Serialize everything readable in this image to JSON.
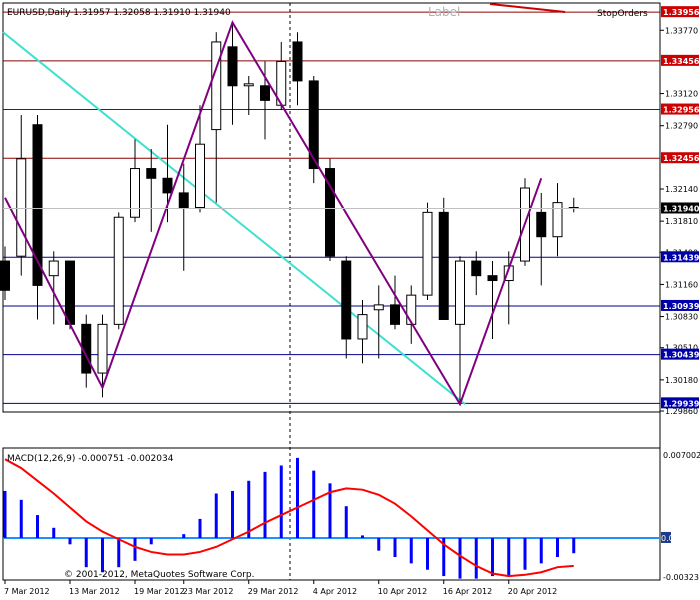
{
  "header": {
    "symbol_line": "EURUSD,Daily  1.31957 1.32058 1.31910 1.31940",
    "label_text": "Label",
    "stop_orders": "StopOrders"
  },
  "indicator": {
    "title": "MACD(12,26,9) -0.000751 -0.002034"
  },
  "copyright": "© 2001-2012, MetaQuotes Software Corp.",
  "colors": {
    "up_candle": "#ffffff",
    "down_candle": "#000000",
    "resistance_line": "#8b0000",
    "support_line": "#00008b",
    "zigzag": "#800080",
    "trendline": "#40e0d0",
    "macd_histogram": "#0000ff",
    "macd_signal": "#ff0000",
    "zero_line": "#1e90ff",
    "price_tag_red": "#cc0000",
    "price_tag_blue": "#0000aa",
    "current_price_tag": "#000000"
  },
  "price_axis": {
    "labels": [
      "1.33770",
      "1.33120",
      "1.32790",
      "1.32140",
      "1.31810",
      "1.31490",
      "1.31160",
      "1.30830",
      "1.30510",
      "1.30180",
      "1.29860"
    ],
    "tags": [
      {
        "text": "1.33956",
        "kind": "resistance"
      },
      {
        "text": "1.33456",
        "kind": "resistance"
      },
      {
        "text": "1.32956",
        "kind": "resistance"
      },
      {
        "text": "1.32456",
        "kind": "resistance"
      },
      {
        "text": "1.31940",
        "kind": "current"
      },
      {
        "text": "1.31439",
        "kind": "support"
      },
      {
        "text": "1.30939",
        "kind": "support"
      },
      {
        "text": "1.30439",
        "kind": "support"
      },
      {
        "text": "1.29939",
        "kind": "support"
      }
    ]
  },
  "macd_axis": {
    "labels": [
      "0.007002",
      "0.00",
      "-0.00323"
    ]
  },
  "time_axis": {
    "labels": [
      "7 Mar 2012",
      "13 Mar 2012",
      "19 Mar 2012",
      "23 Mar 2012",
      "29 Mar 2012",
      "4 Apr 2012",
      "10 Apr 2012",
      "16 Apr 2012",
      "20 Apr 2012"
    ]
  },
  "chart_data": {
    "type": "candlestick",
    "symbol": "EURUSD",
    "timeframe": "Daily",
    "ylim": [
      1.2985,
      1.3405
    ],
    "candles": [
      {
        "o": 1.314,
        "h": 1.3155,
        "l": 1.31,
        "c": 1.311
      },
      {
        "o": 1.3145,
        "h": 1.329,
        "l": 1.3125,
        "c": 1.3245
      },
      {
        "o": 1.328,
        "h": 1.329,
        "l": 1.308,
        "c": 1.3115
      },
      {
        "o": 1.3125,
        "h": 1.315,
        "l": 1.3075,
        "c": 1.314
      },
      {
        "o": 1.314,
        "h": 1.314,
        "l": 1.307,
        "c": 1.3075
      },
      {
        "o": 1.3075,
        "h": 1.3085,
        "l": 1.301,
        "c": 1.3025
      },
      {
        "o": 1.3025,
        "h": 1.3085,
        "l": 1.3,
        "c": 1.3075
      },
      {
        "o": 1.3075,
        "h": 1.319,
        "l": 1.307,
        "c": 1.3185
      },
      {
        "o": 1.3185,
        "h": 1.3265,
        "l": 1.318,
        "c": 1.3235
      },
      {
        "o": 1.3235,
        "h": 1.3255,
        "l": 1.317,
        "c": 1.3225
      },
      {
        "o": 1.3225,
        "h": 1.328,
        "l": 1.318,
        "c": 1.321
      },
      {
        "o": 1.321,
        "h": 1.324,
        "l": 1.313,
        "c": 1.3195
      },
      {
        "o": 1.3195,
        "h": 1.33,
        "l": 1.319,
        "c": 1.326
      },
      {
        "o": 1.3275,
        "h": 1.3375,
        "l": 1.32,
        "c": 1.3365
      },
      {
        "o": 1.336,
        "h": 1.3385,
        "l": 1.328,
        "c": 1.332
      },
      {
        "o": 1.332,
        "h": 1.333,
        "l": 1.329,
        "c": 1.3322
      },
      {
        "o": 1.332,
        "h": 1.3345,
        "l": 1.3265,
        "c": 1.3305
      },
      {
        "o": 1.33,
        "h": 1.3365,
        "l": 1.3295,
        "c": 1.3345
      },
      {
        "o": 1.3365,
        "h": 1.3375,
        "l": 1.33,
        "c": 1.3325
      },
      {
        "o": 1.3325,
        "h": 1.333,
        "l": 1.322,
        "c": 1.3235
      },
      {
        "o": 1.3235,
        "h": 1.3245,
        "l": 1.314,
        "c": 1.3145
      },
      {
        "o": 1.314,
        "h": 1.3145,
        "l": 1.304,
        "c": 1.306
      },
      {
        "o": 1.306,
        "h": 1.31,
        "l": 1.3035,
        "c": 1.3085
      },
      {
        "o": 1.309,
        "h": 1.3115,
        "l": 1.304,
        "c": 1.3095
      },
      {
        "o": 1.3095,
        "h": 1.3125,
        "l": 1.307,
        "c": 1.3075
      },
      {
        "o": 1.3075,
        "h": 1.3115,
        "l": 1.3055,
        "c": 1.3105
      },
      {
        "o": 1.3105,
        "h": 1.32,
        "l": 1.31,
        "c": 1.319
      },
      {
        "o": 1.319,
        "h": 1.3205,
        "l": 1.308,
        "c": 1.308
      },
      {
        "o": 1.3075,
        "h": 1.3145,
        "l": 1.2995,
        "c": 1.314
      },
      {
        "o": 1.314,
        "h": 1.315,
        "l": 1.3105,
        "c": 1.3125
      },
      {
        "o": 1.3125,
        "h": 1.314,
        "l": 1.306,
        "c": 1.312
      },
      {
        "o": 1.312,
        "h": 1.315,
        "l": 1.3075,
        "c": 1.3135
      },
      {
        "o": 1.314,
        "h": 1.3225,
        "l": 1.3135,
        "c": 1.3215
      },
      {
        "o": 1.319,
        "h": 1.321,
        "l": 1.3115,
        "c": 1.3165
      },
      {
        "o": 1.3165,
        "h": 1.322,
        "l": 1.3145,
        "c": 1.32
      },
      {
        "o": 1.3195,
        "h": 1.3205,
        "l": 1.319,
        "c": 1.3194
      }
    ],
    "horizontal_levels": {
      "resistance": [
        1.33956,
        1.33456,
        1.32956,
        1.32456
      ],
      "support": [
        1.31439,
        1.30939,
        1.30439,
        1.29939
      ]
    },
    "zigzag": [
      {
        "bar": 0,
        "price": 1.3205
      },
      {
        "bar": 6,
        "price": 1.301
      },
      {
        "bar": 14,
        "price": 1.3385
      },
      {
        "bar": 28,
        "price": 1.2993
      },
      {
        "bar": 33,
        "price": 1.3225
      }
    ],
    "trendline": [
      {
        "bar": 0,
        "price": 1.3375
      },
      {
        "bar": 28,
        "price": 1.2993
      }
    ],
    "macd": {
      "title": "MACD(12,26,9)",
      "main": -0.000751,
      "signal_value": -0.002034,
      "ylim": [
        -0.00323,
        0.007002
      ],
      "histogram": [
        0.0037,
        0.003,
        0.0018,
        0.0008,
        -0.0005,
        -0.0023,
        -0.0027,
        -0.0023,
        -0.0018,
        -0.0005,
        0.0,
        0.0003,
        0.0015,
        0.0035,
        0.0037,
        0.0045,
        0.0052,
        0.0057,
        0.0063,
        0.0053,
        0.0043,
        0.0025,
        0.0002,
        -0.001,
        -0.0015,
        -0.002,
        -0.0025,
        -0.003,
        -0.0032,
        -0.0032,
        -0.003,
        -0.003,
        -0.0025,
        -0.002,
        -0.0015,
        -0.0012
      ],
      "signal": [
        0.0062,
        0.0055,
        0.0045,
        0.0035,
        0.0024,
        0.0013,
        0.0005,
        -0.0001,
        -0.0007,
        -0.0011,
        -0.0013,
        -0.0013,
        -0.0011,
        -0.0007,
        -0.0001,
        0.0005,
        0.0012,
        0.0018,
        0.0024,
        0.003,
        0.0036,
        0.0039,
        0.0038,
        0.0034,
        0.0027,
        0.0017,
        0.0006,
        -0.0005,
        -0.0014,
        -0.0022,
        -0.0028,
        -0.003,
        -0.0029,
        -0.0027,
        -0.0023,
        -0.0022
      ]
    }
  }
}
